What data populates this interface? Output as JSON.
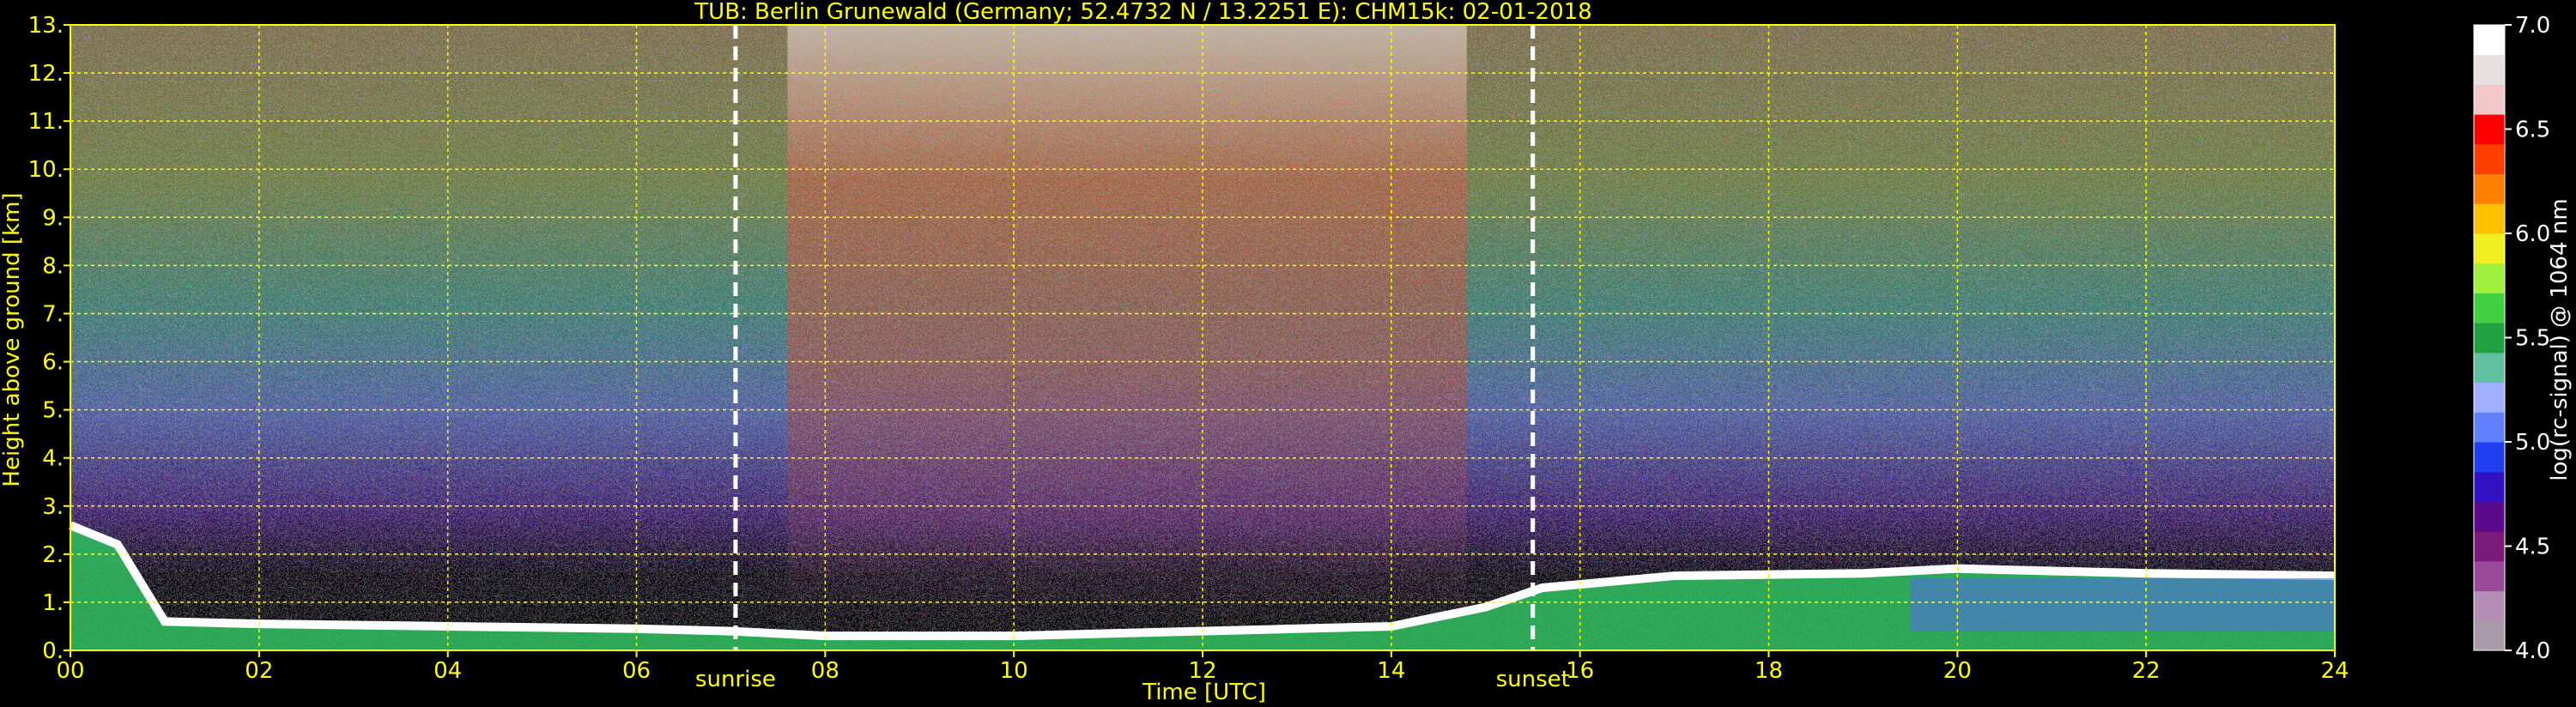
{
  "chart_data": {
    "type": "heatmap",
    "title": "TUB: Berlin Grunewald (Germany; 52.4732 N / 13.2251 E):    CHM15k: 02-01-2018",
    "xlabel": "Time [UTC]",
    "ylabel": "Height above ground [km]",
    "xlim": [
      0,
      24
    ],
    "ylim": [
      0,
      13
    ],
    "x_ticks": [
      "00",
      "02",
      "04",
      "06",
      "08",
      "10",
      "12",
      "14",
      "16",
      "18",
      "20",
      "22",
      "24"
    ],
    "y_ticks": [
      "0.",
      "1.",
      "2.",
      "3.",
      "4.",
      "5.",
      "6.",
      "7.",
      "8.",
      "9.",
      "10.",
      "11.",
      "12.",
      "13."
    ],
    "grid": true,
    "annotations": [
      {
        "label": "sunrise",
        "x": 7.05
      },
      {
        "label": "sunset",
        "x": 15.5
      }
    ],
    "colorbar": {
      "label": "log(rc-signal) @ 1064 nm",
      "range": [
        4.0,
        7.0
      ],
      "ticks": [
        "4.0",
        "4.5",
        "5.0",
        "5.5",
        "6.0",
        "6.5",
        "7.0"
      ],
      "colors": [
        "#a89aa8",
        "#b48eb4",
        "#9a4a9a",
        "#7a1a7a",
        "#5a0a8a",
        "#3010c0",
        "#2040f0",
        "#6080ff",
        "#a0b0ff",
        "#60c0a0",
        "#20a040",
        "#40d040",
        "#a0f040",
        "#f0f020",
        "#ffc000",
        "#ff8000",
        "#ff4000",
        "#ff0000",
        "#f0c8c8",
        "#e8e0e0",
        "#ffffff"
      ]
    },
    "boundary_layer": [
      {
        "t": 0,
        "h": 2.6
      },
      {
        "t": 0.5,
        "h": 2.2
      },
      {
        "t": 1,
        "h": 0.6
      },
      {
        "t": 2,
        "h": 0.55
      },
      {
        "t": 4,
        "h": 0.5
      },
      {
        "t": 6,
        "h": 0.45
      },
      {
        "t": 7,
        "h": 0.4
      },
      {
        "t": 8,
        "h": 0.3
      },
      {
        "t": 10,
        "h": 0.3
      },
      {
        "t": 12,
        "h": 0.4
      },
      {
        "t": 14,
        "h": 0.5
      },
      {
        "t": 15,
        "h": 0.9
      },
      {
        "t": 15.6,
        "h": 1.3
      },
      {
        "t": 17,
        "h": 1.55
      },
      {
        "t": 19,
        "h": 1.6
      },
      {
        "t": 20,
        "h": 1.7
      },
      {
        "t": 22,
        "h": 1.6
      },
      {
        "t": 24,
        "h": 1.55
      }
    ]
  }
}
